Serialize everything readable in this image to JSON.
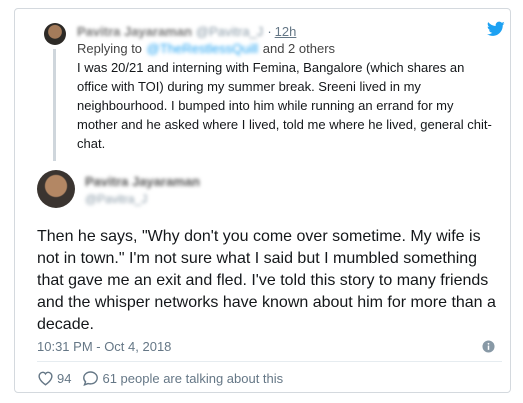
{
  "reply": {
    "author_name": "Pavitra Jayaraman",
    "author_handle": "@Pavitra_J",
    "separator": "·",
    "time": "12h",
    "replying_prefix": "Replying to",
    "replying_mention": "@TheRestlessQuill",
    "replying_suffix": "and 2 others",
    "text": "I was 20/21 and interning with Femina, Bangalore (which shares an office with TOI) during my summer break. Sreeni lived in my neighbourhood. I bumped into him while running an errand for my mother and he asked where I lived, told me where he lived, general chit-chat."
  },
  "tweet": {
    "author_name": "Pavitra Jayaraman",
    "author_handle": "@Pavitra_J",
    "text": "Then he says, \"Why don't you come over sometime. My wife is not in town.\" I'm not sure what I said but I mumbled something that gave me an exit and fled. I've told this story to many friends and the whisper networks have known about him for more than a decade.",
    "timestamp": "10:31 PM - Oct 4, 2018",
    "likes": "94",
    "talking": "61 people are talking about this"
  },
  "colors": {
    "brand": "#1da1f2",
    "text": "#14171a",
    "muted": "#657786",
    "border": "#d4d9de"
  },
  "icons": [
    "twitter-bird-icon",
    "heart-icon",
    "comment-icon",
    "info-icon"
  ]
}
